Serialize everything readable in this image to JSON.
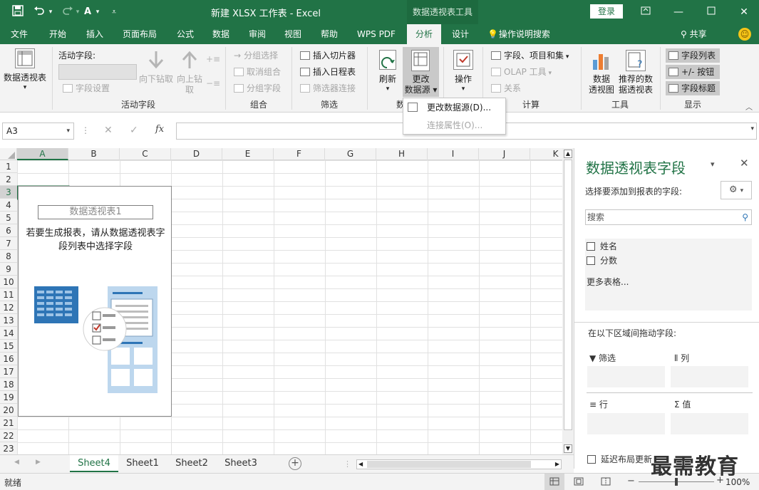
{
  "titlebar": {
    "document_title": "新建 XLSX 工作表 - Excel",
    "context_title": "数据透视表工具",
    "login_label": "登录"
  },
  "tabs": [
    "文件",
    "开始",
    "插入",
    "页面布局",
    "公式",
    "数据",
    "审阅",
    "视图",
    "帮助",
    "WPS PDF",
    "分析",
    "设计"
  ],
  "tell_me": "操作说明搜索",
  "share_label": "共享",
  "ribbon": {
    "pivot_table": "数据透视表",
    "active_field_label": "活动字段:",
    "field_settings": "字段设置",
    "drill_down": "向下钻取",
    "drill_up": "向上钻取",
    "group_active_field": "活动字段",
    "group_selection": "分组选择",
    "ungroup": "取消组合",
    "group_field": "分组字段",
    "group_group": "组合",
    "insert_slicer": "插入切片器",
    "insert_timeline": "插入日程表",
    "filter_connections": "筛选器连接",
    "group_filter": "筛选",
    "refresh": "刷新",
    "change_source": "更改数据源",
    "group_data": "数",
    "actions": "操作",
    "fields_items_sets": "字段、项目和集",
    "olap_tools": "OLAP 工具",
    "relationships": "关系",
    "group_calc": "计算",
    "pivot_chart": "数据透视图",
    "recommended_pivot": "推荐的数据透视表",
    "group_tools": "工具",
    "field_list": "字段列表",
    "plus_minus_buttons": "+/- 按钮",
    "field_headers": "字段标题",
    "group_show": "显示"
  },
  "menu": {
    "change_source": "更改数据源(D)...",
    "connection_props": "连接属性(O)..."
  },
  "formula": {
    "name_box": "A3",
    "fx": "fx"
  },
  "grid": {
    "columns": [
      "A",
      "B",
      "C",
      "D",
      "E",
      "F",
      "G",
      "H",
      "I",
      "J",
      "K"
    ],
    "rows": [
      "1",
      "2",
      "3",
      "4",
      "5",
      "6",
      "7",
      "8",
      "9",
      "10",
      "11",
      "12",
      "13",
      "14",
      "15",
      "16",
      "17",
      "18",
      "19",
      "20",
      "21",
      "22",
      "23"
    ]
  },
  "pivot": {
    "name": "数据透视表1",
    "hint": "若要生成报表，请从数据透视表字段列表中选择字段"
  },
  "pane": {
    "title": "数据透视表字段",
    "subtitle": "选择要添加到报表的字段:",
    "search_placeholder": "搜索",
    "fields": [
      "姓名",
      "分数"
    ],
    "more_tables": "更多表格...",
    "drag_label": "在以下区域间拖动字段:",
    "area_filter": "筛选",
    "area_columns": "列",
    "area_rows": "行",
    "area_values": "值",
    "defer_update": "延迟布局更新"
  },
  "sheets": [
    "Sheet4",
    "Sheet1",
    "Sheet2",
    "Sheet3"
  ],
  "status": {
    "ready": "就绪",
    "zoom": "100%"
  },
  "watermark": "最需教育",
  "colors": {
    "accent": "#217346",
    "ribbon_bg": "#f3f3f3"
  }
}
